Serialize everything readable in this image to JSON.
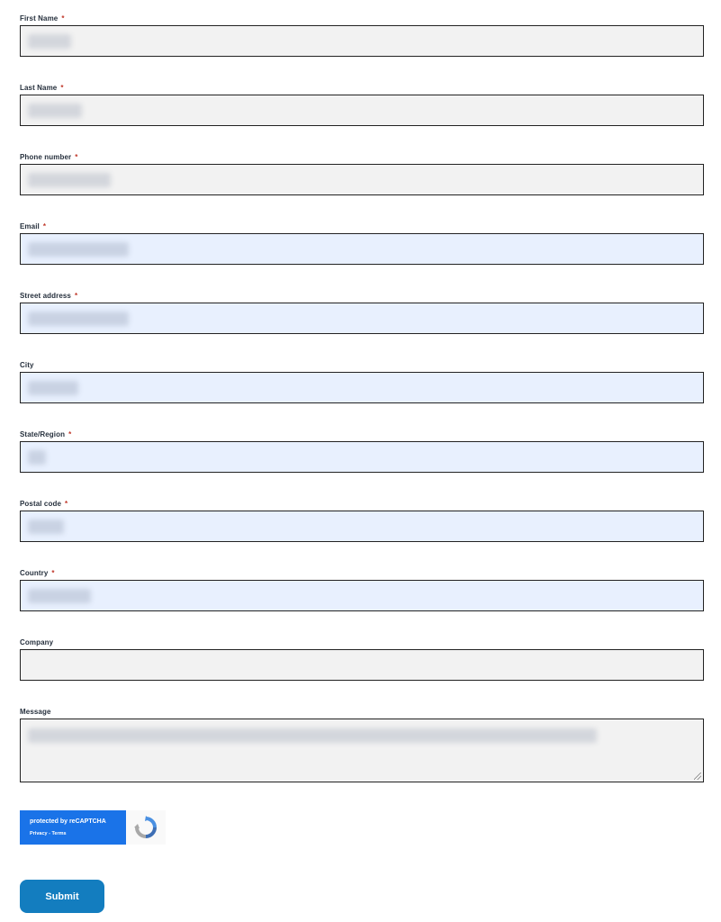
{
  "form": {
    "required_marker": "*",
    "fields": {
      "first_name": {
        "label": "First Name",
        "required": true
      },
      "last_name": {
        "label": "Last Name",
        "required": true
      },
      "phone": {
        "label": "Phone number",
        "required": true
      },
      "email": {
        "label": "Email",
        "required": true
      },
      "street": {
        "label": "Street address",
        "required": true
      },
      "city": {
        "label": "City",
        "required": false
      },
      "state": {
        "label": "State/Region",
        "required": true
      },
      "postal": {
        "label": "Postal code",
        "required": true
      },
      "country": {
        "label": "Country",
        "required": true
      },
      "company": {
        "label": "Company",
        "required": false
      },
      "message": {
        "label": "Message",
        "required": false
      }
    },
    "colors": {
      "field_bg": "#f2f2f2",
      "autofill_bg": "#e8f0fe",
      "border": "#222222",
      "accent": "#137dbf"
    }
  },
  "recaptcha": {
    "title": "protected by reCAPTCHA",
    "links": "Privacy - Terms",
    "icon": "recaptcha-logo-icon",
    "color": "#1a73e8"
  },
  "submit": {
    "label": "Submit"
  }
}
